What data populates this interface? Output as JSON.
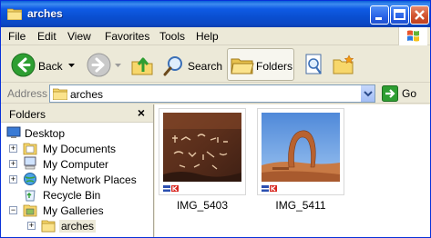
{
  "window": {
    "title": "arches"
  },
  "menu": {
    "items": [
      "File",
      "Edit",
      "View",
      "Favorites",
      "Tools",
      "Help"
    ]
  },
  "toolbar": {
    "back_label": "Back",
    "search_label": "Search",
    "folders_label": "Folders"
  },
  "address": {
    "label": "Address",
    "value": "arches",
    "go_label": "Go"
  },
  "folders_pane": {
    "title": "Folders",
    "items": [
      {
        "label": "Desktop"
      },
      {
        "label": "My Documents"
      },
      {
        "label": "My Computer"
      },
      {
        "label": "My Network Places"
      },
      {
        "label": "Recycle Bin"
      },
      {
        "label": "My Galleries"
      },
      {
        "label": "arches"
      }
    ]
  },
  "files": [
    {
      "name": "IMG_5403"
    },
    {
      "name": "IMG_5411"
    }
  ],
  "colors": {
    "titlebar": "#0a4fd1",
    "selection": "#ece9d8",
    "accent": "#316ac5"
  }
}
